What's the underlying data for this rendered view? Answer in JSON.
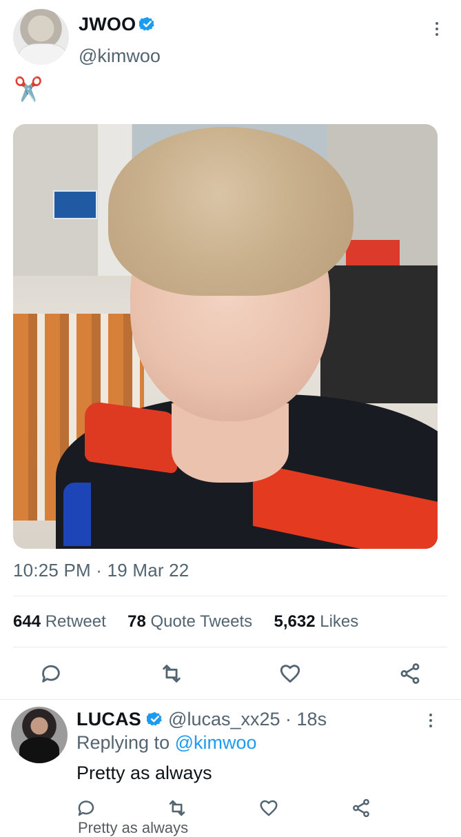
{
  "tweet": {
    "author_name": "JWOO",
    "author_handle": "@kimwoo",
    "text": "✂️",
    "timestamp": "10:25 PM · 19 Mar 22",
    "stats": {
      "retweets_count": "644",
      "retweets_label": "Retweet",
      "quotes_count": "78",
      "quotes_label": "Quote Tweets",
      "likes_count": "5,632",
      "likes_label": "Likes"
    }
  },
  "reply": {
    "author_name": "LUCAS",
    "author_handle": "@lucas_xx25",
    "time_ago": "· 18s",
    "replying_to_label": "Replying to",
    "replying_to_handle": "@kimwoo",
    "text": "Pretty as always",
    "partial_next_text": "Pretty as always"
  },
  "icons": {
    "verified": "verified-badge-icon",
    "more": "more-options-icon",
    "reply": "reply-icon",
    "retweet": "retweet-icon",
    "like": "like-icon",
    "share": "share-icon"
  },
  "colors": {
    "accent": "#1d9bf0",
    "text": "#0f1419",
    "muted": "#536471"
  }
}
